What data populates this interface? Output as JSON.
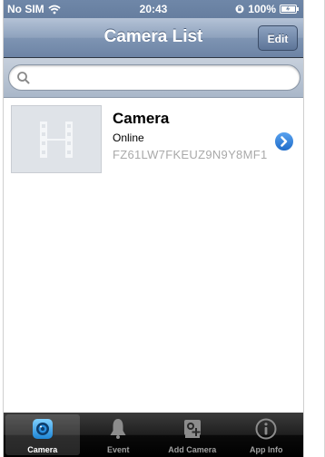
{
  "status_bar": {
    "carrier": "No SIM",
    "time": "20:43",
    "battery": "100%"
  },
  "nav": {
    "title": "Camera List",
    "edit_label": "Edit"
  },
  "search": {
    "value": "",
    "placeholder": ""
  },
  "cameras": [
    {
      "name": "Camera",
      "status": "Online",
      "id": "FZ61LW7FKEUZ9N9Y8MF1"
    }
  ],
  "tabs": [
    {
      "label": "Camera",
      "icon": "camera-lens-icon",
      "selected": true
    },
    {
      "label": "Event",
      "icon": "bell-icon",
      "selected": false
    },
    {
      "label": "Add Camera",
      "icon": "add-camera-icon",
      "selected": false
    },
    {
      "label": "App Info",
      "icon": "info-icon",
      "selected": false
    }
  ],
  "colors": {
    "nav_bar": "#7e94b3",
    "accent_blue": "#2f7fd8",
    "tab_bar": "#000000",
    "id_text": "#a9a9a9"
  }
}
